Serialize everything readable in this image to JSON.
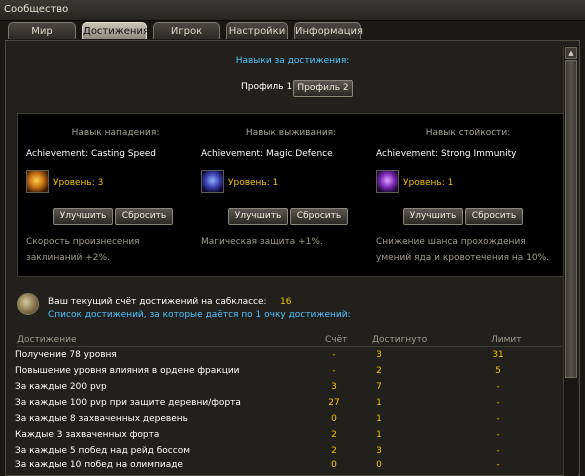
{
  "window": {
    "title": "Сообщество"
  },
  "tabs": [
    {
      "label": "Мир",
      "active": false
    },
    {
      "label": "Достижения",
      "active": true
    },
    {
      "label": "Игрок",
      "active": false
    },
    {
      "label": "Настройки",
      "active": false
    },
    {
      "label": "Информация",
      "active": false
    }
  ],
  "skills_heading": "Навыки за достижения:",
  "profile": {
    "label": "Профиль 1",
    "button": "Профиль 2"
  },
  "skill_columns": [
    {
      "category": "Навык нападения:",
      "name": "Achievement: Casting Speed",
      "icon": "casting-speed-icon",
      "level": "Уровень: 3",
      "improve": "Улучшить",
      "reset": "Сбросить",
      "description": "Скорость произнесения заклинаний +2%."
    },
    {
      "category": "Навык выживания:",
      "name": "Achievement: Magic Defence",
      "icon": "magic-defence-icon",
      "level": "Уровень: 1",
      "improve": "Улучшить",
      "reset": "Сбросить",
      "description": "Магическая защита +1%."
    },
    {
      "category": "Навык стойкости:",
      "name": "Achievement: Strong Immunity",
      "icon": "strong-immunity-icon",
      "level": "Уровень: 1",
      "improve": "Улучшить",
      "reset": "Сбросить",
      "description": "Снижение шанса прохождения умений яда и кровотечения на 10%."
    }
  ],
  "score": {
    "label": "Ваш текущий счёт достижений на сабклассе:",
    "value": "16",
    "icon": "medal-icon"
  },
  "list_title": "Список достижений, за которые даётся по 1 очку достижений:",
  "table": {
    "headers": [
      "Достижение",
      "Счёт",
      "Достигнуто",
      "Лимит"
    ],
    "rows": [
      [
        "Получение 78 уровня",
        "-",
        "3",
        "31"
      ],
      [
        "Повышение уровня влияния в ордене фракции",
        "-",
        "2",
        "5"
      ],
      [
        "За каждые 200 pvp",
        "3",
        "7",
        "-"
      ],
      [
        "За каждые 100 pvp при защите деревни/форта",
        "27",
        "1",
        "-"
      ],
      [
        "За каждые 8 захваченных деревень",
        "0",
        "1",
        "-"
      ],
      [
        "Каждые 3 захваченных форта",
        "2",
        "1",
        "-"
      ],
      [
        "За каждые 5 побед над рейд боссом",
        "2",
        "3",
        "-"
      ],
      [
        "За каждые 10 побед на олимпиаде",
        "0",
        "0",
        "-"
      ]
    ]
  },
  "colors": {
    "accent_blue": "#4fc3ff",
    "value_yellow": "#f5c400",
    "background": "#22201c"
  }
}
